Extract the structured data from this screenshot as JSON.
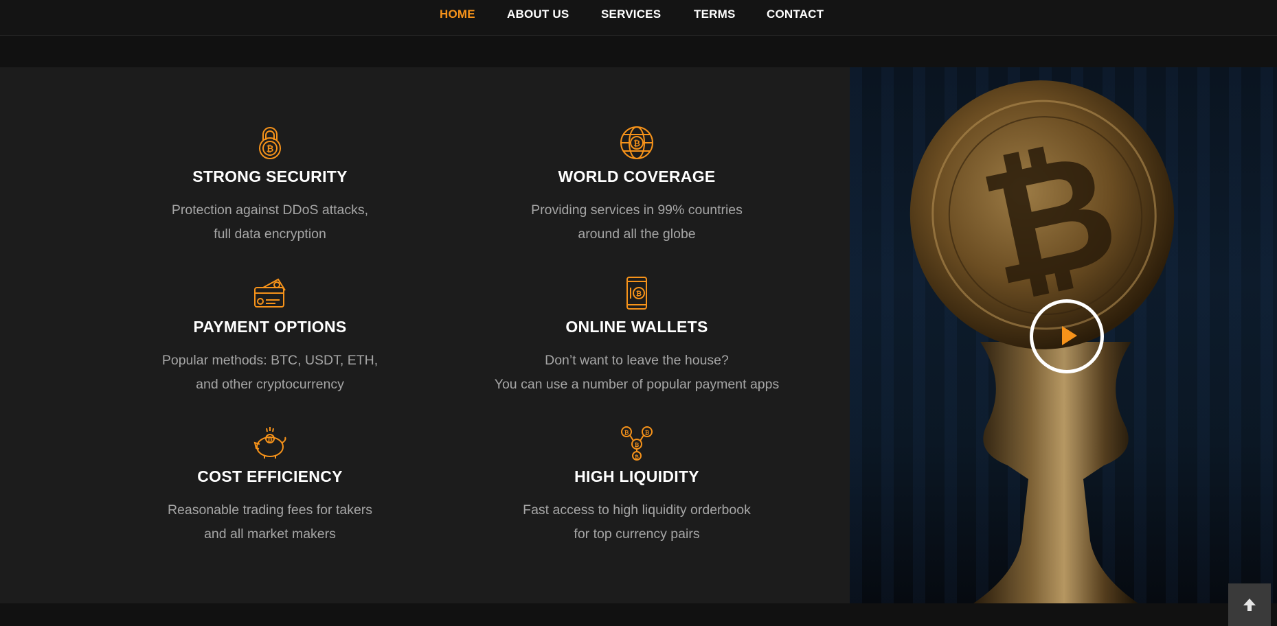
{
  "nav": {
    "items": [
      {
        "label": "HOME",
        "active": true
      },
      {
        "label": "ABOUT US",
        "active": false
      },
      {
        "label": "SERVICES",
        "active": false
      },
      {
        "label": "TERMS",
        "active": false
      },
      {
        "label": "CONTACT",
        "active": false
      }
    ]
  },
  "features": [
    {
      "icon": "bitcoin-padlock-icon",
      "title": "STRONG SECURITY",
      "line1": "Protection against DDoS attacks,",
      "line2": "full data encryption"
    },
    {
      "icon": "bitcoin-globe-icon",
      "title": "WORLD COVERAGE",
      "line1": "Providing services in 99% countries",
      "line2": "around all the globe"
    },
    {
      "icon": "bitcoin-card-icon",
      "title": "PAYMENT OPTIONS",
      "line1": "Popular methods: BTC, USDT, ETH,",
      "line2": "and other cryptocurrency"
    },
    {
      "icon": "bitcoin-phone-icon",
      "title": "ONLINE WALLETS",
      "line1": "Don’t want to leave the house?",
      "line2": "You can use a number of popular payment apps"
    },
    {
      "icon": "bitcoin-piggy-bank-icon",
      "title": "COST EFFICIENCY",
      "line1": "Reasonable trading fees for takers",
      "line2": "and all market makers"
    },
    {
      "icon": "bitcoin-network-icon",
      "title": "HIGH LIQUIDITY",
      "line1": "Fast access to high liquidity orderbook",
      "line2": "for top currency pairs"
    }
  ],
  "media": {
    "image": "bitcoin-coin-photo",
    "play_icon": "play-icon"
  },
  "to_top": {
    "icon": "arrow-up-icon"
  },
  "colors": {
    "accent": "#f7931a",
    "panel": "#1c1c1c",
    "text": "#ffffff",
    "muted": "#a6a6a6"
  }
}
